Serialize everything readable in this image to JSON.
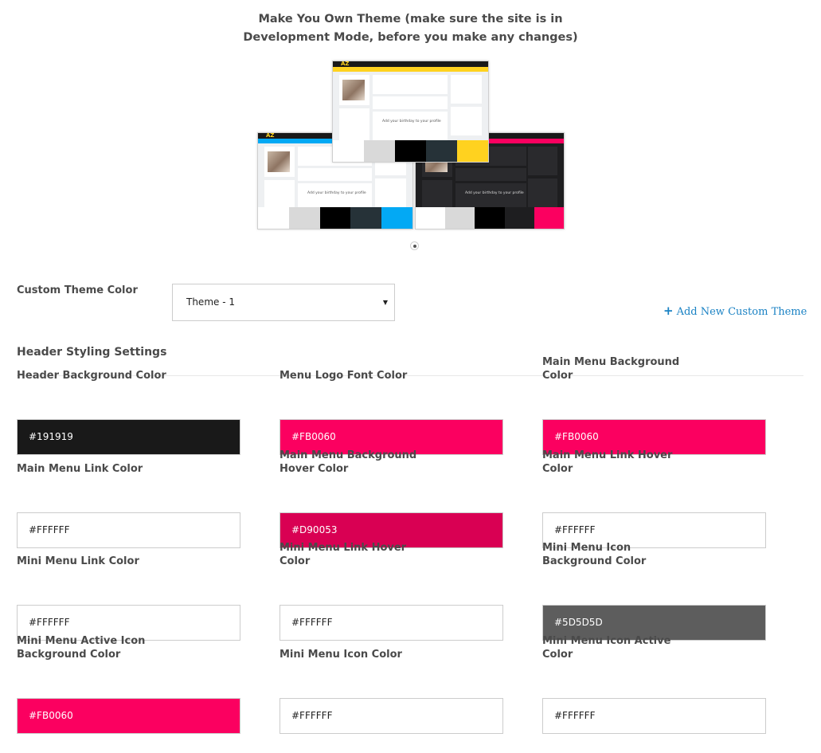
{
  "page_title": {
    "line1": "Make You Own Theme (make sure the site is in",
    "line2": "Development Mode, before you make any changes)"
  },
  "carousel": {
    "previews": [
      {
        "name": "blue-theme",
        "logo": "AZ",
        "logo_color": "#FFD21F",
        "nav_color": "#03A9F4",
        "page_bg": "#EEF0F2",
        "card_bg": "#FFFFFF",
        "birthday_text": "Add your birthday to your profile",
        "swatches": [
          "#FFFFFF",
          "#D9D9D9",
          "#000000",
          "#263238",
          "#03A9F4"
        ]
      },
      {
        "name": "pink-dark-theme",
        "logo": "AZ",
        "logo_color": "#FB0060",
        "nav_color": "#FB0060",
        "page_bg": "#1E1E20",
        "card_bg": "#2A2A2D",
        "birthday_text": "Add your birthday to your profile",
        "swatches": [
          "#FFFFFF",
          "#D9D9D9",
          "#000000",
          "#1E1E20",
          "#FB0060"
        ]
      },
      {
        "name": "yellow-theme",
        "logo": "AZ",
        "logo_color": "#FFD21F",
        "nav_color": "#FFD21F",
        "page_bg": "#EEF0F2",
        "card_bg": "#FFFFFF",
        "birthday_text": "Add your birthday to your profile",
        "swatches": [
          "#FFFFFF",
          "#D9D9D9",
          "#000000",
          "#263238",
          "#FFD21F"
        ]
      }
    ],
    "active_slide": 1,
    "slide_count": 1
  },
  "custom_theme": {
    "label": "Custom Theme Color",
    "selected": "Theme - 1",
    "caret": "▼",
    "add_link": {
      "icon": "+",
      "label": "Add New Custom Theme",
      "color": "#1A82C4"
    }
  },
  "header_section": {
    "title": "Header Styling Settings",
    "fields": [
      {
        "label": "Header Background Color",
        "value": "#191919",
        "bg": "#191919",
        "fg": "#FFFFFF"
      },
      {
        "label": "Menu Logo Font Color",
        "value": "#FB0060",
        "bg": "#FB0060",
        "fg": "#FFFFFF"
      },
      {
        "label": "Main Menu Background Color",
        "value": "#FB0060",
        "bg": "#FB0060",
        "fg": "#FFFFFF"
      },
      {
        "label": "Main Menu Link Color",
        "value": "#FFFFFF",
        "bg": "#FFFFFF",
        "fg": "#222222"
      },
      {
        "label": "Main Menu Background Hover Color",
        "value": "#D90053",
        "bg": "#D90053",
        "fg": "#FFFFFF"
      },
      {
        "label": "Main Menu Link Hover Color",
        "value": "#FFFFFF",
        "bg": "#FFFFFF",
        "fg": "#222222"
      },
      {
        "label": "Mini Menu Link Color",
        "value": "#FFFFFF",
        "bg": "#FFFFFF",
        "fg": "#222222"
      },
      {
        "label": "Mini Menu Link Hover Color",
        "value": "#FFFFFF",
        "bg": "#FFFFFF",
        "fg": "#222222"
      },
      {
        "label": "Mini Menu Icon Background Color",
        "value": "#5D5D5D",
        "bg": "#5D5D5D",
        "fg": "#FFFFFF"
      },
      {
        "label": "Mini Menu Active Icon Background Color",
        "value": "#FB0060",
        "bg": "#FB0060",
        "fg": "#FFFFFF"
      },
      {
        "label": "Mini Menu Icon Color",
        "value": "#FFFFFF",
        "bg": "#FFFFFF",
        "fg": "#222222"
      },
      {
        "label": "Mini Menu Icon Active Color",
        "value": "#FFFFFF",
        "bg": "#FFFFFF",
        "fg": "#222222"
      }
    ]
  }
}
